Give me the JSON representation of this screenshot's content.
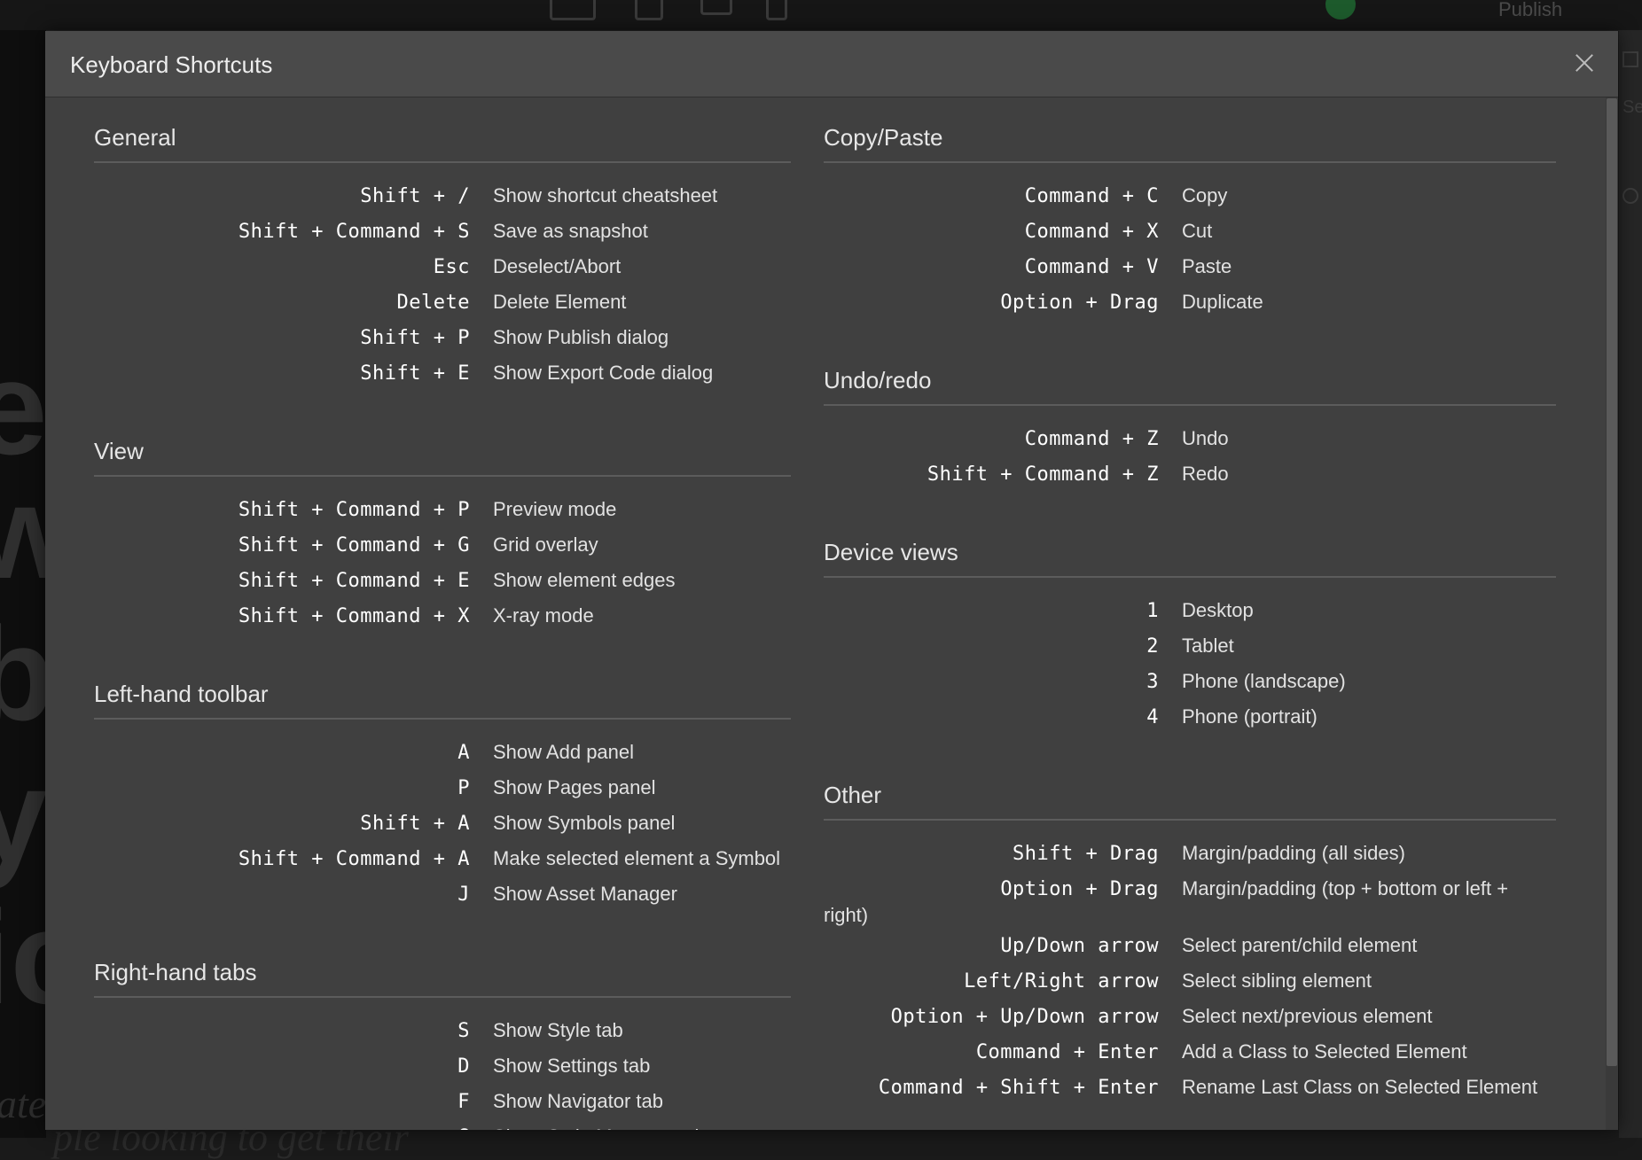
{
  "modal": {
    "title": "Keyboard Shortcuts",
    "close_icon": "close-icon"
  },
  "left_sections": [
    {
      "title": "General",
      "items": [
        {
          "keys": "Shift + /",
          "desc": "Show shortcut cheatsheet"
        },
        {
          "keys": "Shift + Command + S",
          "desc": "Save as snapshot"
        },
        {
          "keys": "Esc",
          "desc": "Deselect/Abort"
        },
        {
          "keys": "Delete",
          "desc": "Delete Element"
        },
        {
          "keys": "Shift + P",
          "desc": "Show Publish dialog"
        },
        {
          "keys": "Shift + E",
          "desc": "Show Export Code dialog"
        }
      ]
    },
    {
      "title": "View",
      "items": [
        {
          "keys": "Shift + Command + P",
          "desc": "Preview mode"
        },
        {
          "keys": "Shift + Command + G",
          "desc": "Grid overlay"
        },
        {
          "keys": "Shift + Command + E",
          "desc": "Show element edges"
        },
        {
          "keys": "Shift + Command + X",
          "desc": "X-ray mode"
        }
      ]
    },
    {
      "title": "Left-hand toolbar",
      "items": [
        {
          "keys": "A",
          "desc": "Show Add panel"
        },
        {
          "keys": "P",
          "desc": "Show Pages panel"
        },
        {
          "keys": "Shift + A",
          "desc": "Show Symbols panel"
        },
        {
          "keys": "Shift + Command + A",
          "desc": "Make selected element a Symbol"
        },
        {
          "keys": "J",
          "desc": "Show Asset Manager"
        }
      ]
    },
    {
      "title": "Right-hand tabs",
      "items": [
        {
          "keys": "S",
          "desc": "Show Style tab"
        },
        {
          "keys": "D",
          "desc": "Show Settings tab"
        },
        {
          "keys": "F",
          "desc": "Show Navigator tab"
        },
        {
          "keys": "G",
          "desc": "Show Style Manager tab"
        }
      ]
    }
  ],
  "right_sections": [
    {
      "title": "Copy/Paste",
      "items": [
        {
          "keys": "Command + C",
          "desc": "Copy"
        },
        {
          "keys": "Command + X",
          "desc": "Cut"
        },
        {
          "keys": "Command + V",
          "desc": "Paste"
        },
        {
          "keys": "Option + Drag",
          "desc": "Duplicate"
        }
      ]
    },
    {
      "title": "Undo/redo",
      "items": [
        {
          "keys": "Command + Z",
          "desc": "Undo"
        },
        {
          "keys": "Shift + Command + Z",
          "desc": "Redo"
        }
      ]
    },
    {
      "title": "Device views",
      "items": [
        {
          "keys": "1",
          "desc": "Desktop"
        },
        {
          "keys": "2",
          "desc": "Tablet"
        },
        {
          "keys": "3",
          "desc": "Phone (landscape)"
        },
        {
          "keys": "4",
          "desc": "Phone (portrait)"
        }
      ]
    },
    {
      "title": "Other",
      "items": [
        {
          "keys": "Shift + Drag",
          "desc": "Margin/padding (all sides)"
        },
        {
          "keys": "Option + Drag",
          "desc": "Margin/padding (top + bottom or left +",
          "desc_wrap": "right)"
        },
        {
          "keys": "Up/Down arrow",
          "desc": "Select parent/child element"
        },
        {
          "keys": "Left/Right arrow",
          "desc": "Select sibling element"
        },
        {
          "keys": "Option + Up/Down arrow",
          "desc": "Select next/previous element"
        },
        {
          "keys": "Command + Enter",
          "desc": "Add a Class to Selected Element"
        },
        {
          "keys": "Command + Shift + Enter",
          "desc": "Rename Last Class on Selected Element"
        }
      ]
    }
  ],
  "background": {
    "topbar_publish": "Publish",
    "letters": [
      "e",
      "w",
      "b",
      "yl",
      "ic"
    ],
    "italic_left": "ate",
    "italic_bottom": "ple looking to get their",
    "right_panel_text": "Se"
  }
}
